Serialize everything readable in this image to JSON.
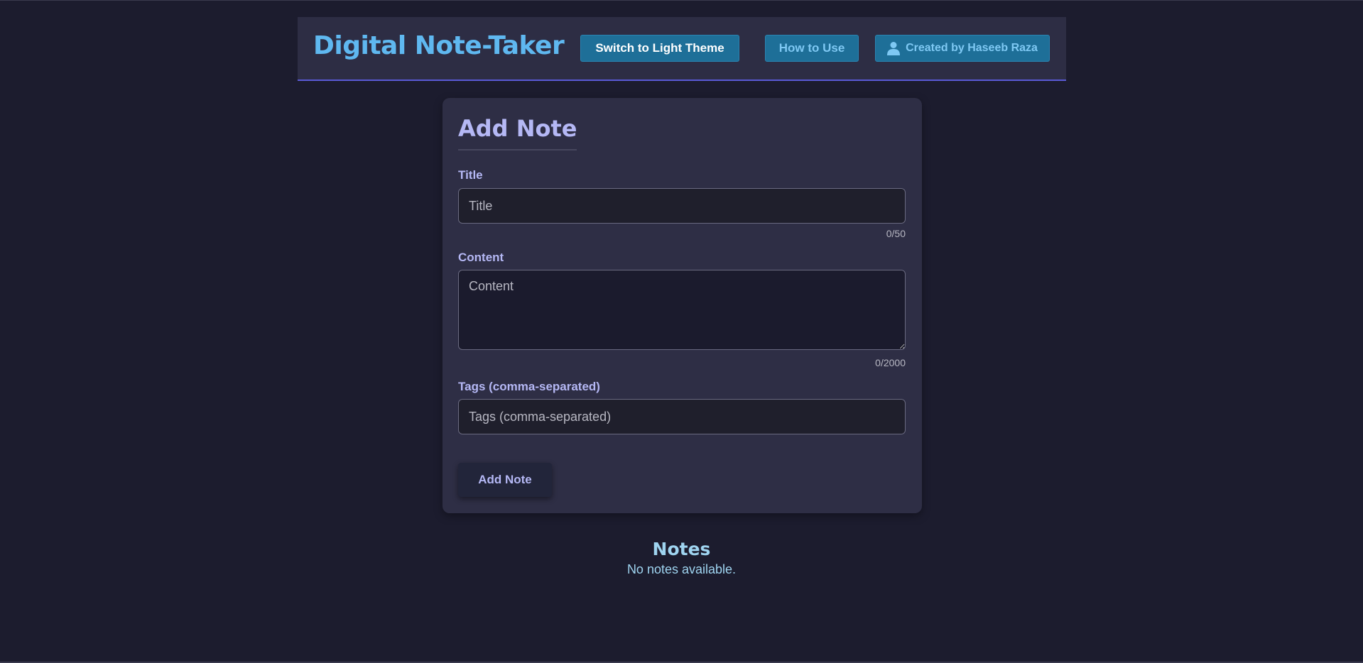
{
  "header": {
    "brand": "Digital Note-Taker",
    "theme_button": "Switch to Light Theme",
    "howto_button": "How to Use",
    "credit_button": "Created by Haseeb Raza",
    "credit_icon": "user-icon"
  },
  "form": {
    "heading": "Add Note",
    "title_label": "Title",
    "title_placeholder": "Title",
    "title_value": "",
    "title_counter": "0/50",
    "content_label": "Content",
    "content_placeholder": "Content",
    "content_value": "",
    "content_counter": "0/2000",
    "tags_label": "Tags (comma-separated)",
    "tags_placeholder": "Tags (comma-separated)",
    "tags_value": "",
    "submit_label": "Add Note"
  },
  "notes": {
    "heading": "Notes",
    "empty_message": "No notes available."
  },
  "colors": {
    "background": "#1c1c2e",
    "panel": "#2d2d44",
    "accent_blue": "#5fb8f0",
    "button_blue": "#1e6f98",
    "lavender": "#b5b8f5",
    "header_border": "#5a5ad6"
  }
}
